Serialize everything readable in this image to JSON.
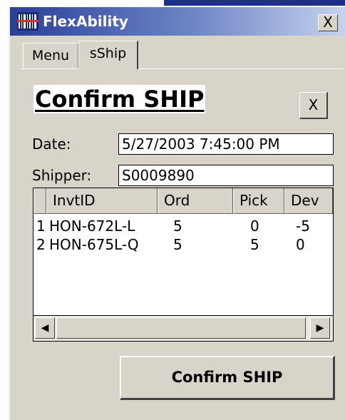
{
  "window": {
    "title": "FlexAbility",
    "close_glyph": "X",
    "icon": "barcode-icon",
    "title_gradient": [
      "#2b3f99",
      "#c6d3ee"
    ]
  },
  "tabs": [
    {
      "label": "Menu",
      "active": false
    },
    {
      "label": "sShip",
      "active": true
    }
  ],
  "form": {
    "heading": "Confirm SHIP",
    "close_label": "X",
    "date_label": "Date:",
    "date_value": "5/27/2003 7:45:00 PM",
    "shipper_label": "Shipper:",
    "shipper_value": "S0009890"
  },
  "grid": {
    "columns": [
      "InvtID",
      "Ord",
      "Pick",
      "Dev"
    ],
    "rows": [
      {
        "num": "1",
        "invtid": "HON-672L-L",
        "ord": "5",
        "pick": "0",
        "dev": "-5"
      },
      {
        "num": "2",
        "invtid": "HON-675L-Q",
        "ord": "5",
        "pick": "5",
        "dev": "0"
      }
    ],
    "scroll_left_glyph": "◀",
    "scroll_right_glyph": "▶"
  },
  "actions": {
    "confirm_label": "Confirm SHIP"
  }
}
